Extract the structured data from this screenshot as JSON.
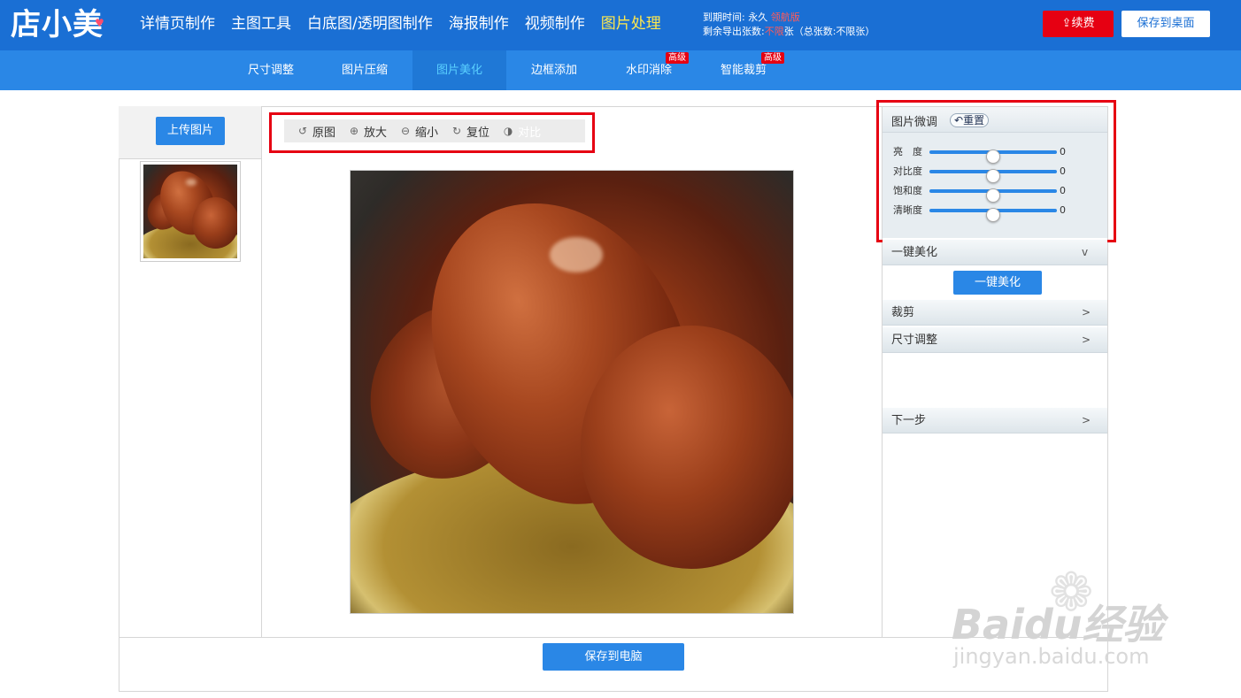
{
  "app": {
    "logo": "店小美"
  },
  "topnav": [
    {
      "label": "详情页制作"
    },
    {
      "label": "主图工具"
    },
    {
      "label": "白底图/透明图制作"
    },
    {
      "label": "海报制作"
    },
    {
      "label": "视频制作"
    },
    {
      "label": "图片处理",
      "active": true
    }
  ],
  "account": {
    "expire_label": "到期时间:",
    "expire_value": "永久",
    "edition": "领航版",
    "remaining_label": "剩余导出张数:",
    "remaining_value": "不限",
    "remaining_unit": "张",
    "total_note": "（总张数:不限张）"
  },
  "header_buttons": {
    "renew": "续费",
    "save_desktop": "保存到桌面"
  },
  "subtabs": [
    {
      "label": "尺寸调整"
    },
    {
      "label": "图片压缩"
    },
    {
      "label": "图片美化",
      "active": true
    },
    {
      "label": "边框添加"
    },
    {
      "label": "水印消除",
      "badge": "高级"
    },
    {
      "label": "智能裁剪",
      "badge": "高级"
    }
  ],
  "left": {
    "upload_label": "上传图片"
  },
  "toolbar": {
    "original": "原图",
    "zoom_in": "放大",
    "zoom_out": "缩小",
    "reset": "复位",
    "compare": "对比"
  },
  "adjust": {
    "title": "图片微调",
    "reset_label": "重置",
    "sliders": [
      {
        "label": "亮　度",
        "value": "0"
      },
      {
        "label": "对比度",
        "value": "0"
      },
      {
        "label": "饱和度",
        "value": "0"
      },
      {
        "label": "清晰度",
        "value": "0"
      }
    ]
  },
  "sections": {
    "beautify": {
      "label": "一键美化",
      "arrow": "v",
      "button": "一键美化"
    },
    "crop": {
      "label": "裁剪",
      "arrow": ">"
    },
    "resize": {
      "label": "尺寸调整",
      "arrow": ">"
    },
    "next": {
      "label": "下一步",
      "arrow": ">"
    }
  },
  "bottom": {
    "save_pc": "保存到电脑"
  },
  "watermark": {
    "brand": "Baidu经验",
    "url": "jingyan.baidu.com"
  },
  "colors": {
    "header_blue": "#1a6fd4",
    "subbar_blue": "#2a87e6",
    "highlight_red": "#e60012",
    "active_yellow": "#ffe84d"
  }
}
